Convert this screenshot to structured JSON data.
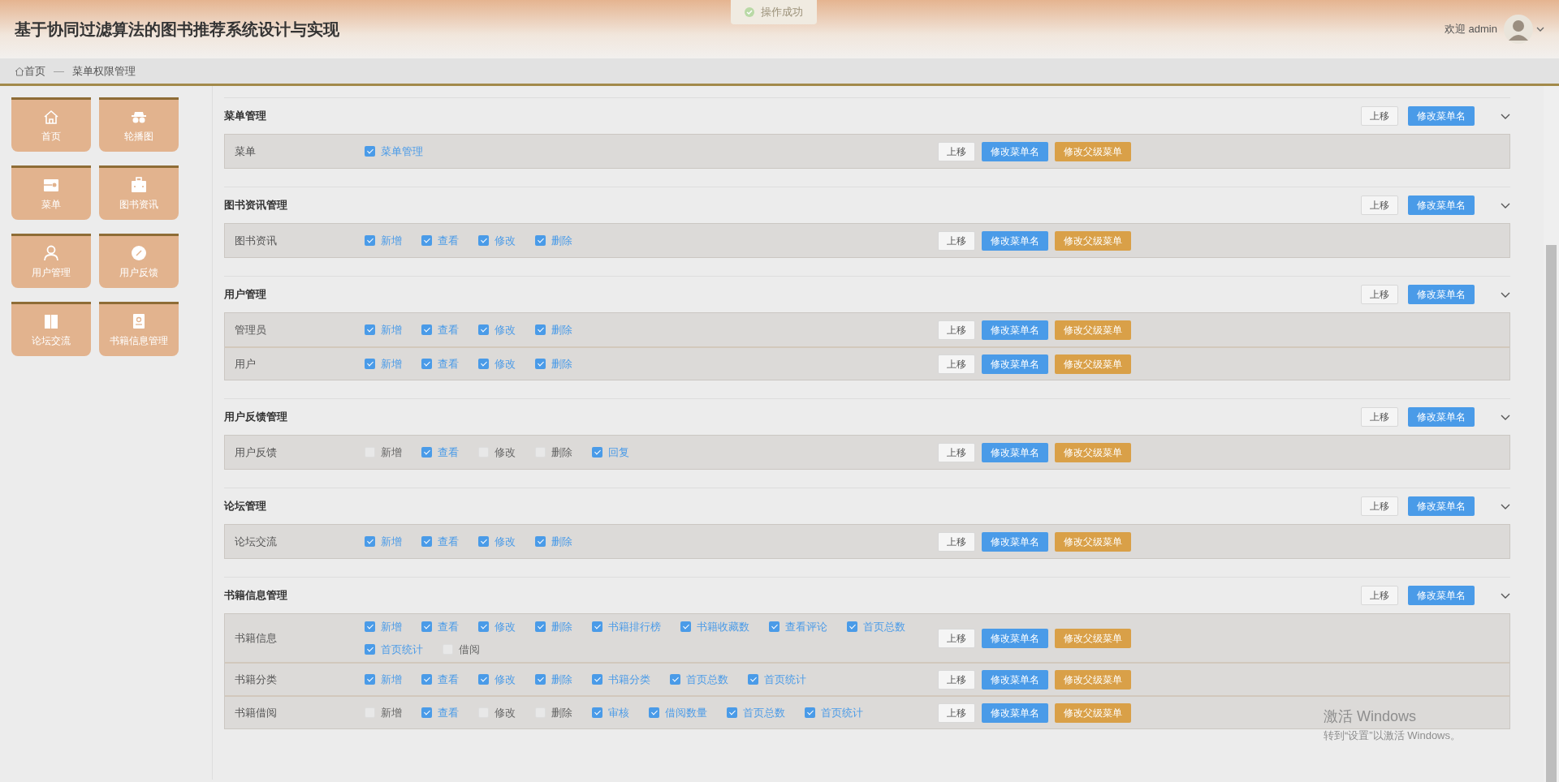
{
  "header": {
    "title": "基于协同过滤算法的图书推荐系统设计与实现",
    "welcome": "欢迎 admin"
  },
  "toast": {
    "text": "操作成功"
  },
  "breadcrumb": [
    {
      "label": "首页"
    },
    {
      "label": "—"
    },
    {
      "label": "菜单权限管理"
    }
  ],
  "sidebar": {
    "items": [
      {
        "label": "首页"
      },
      {
        "label": "轮播图"
      },
      {
        "label": "菜单"
      },
      {
        "label": "图书资讯"
      },
      {
        "label": "用户管理"
      },
      {
        "label": "用户反馈"
      },
      {
        "label": "论坛交流"
      },
      {
        "label": "书籍信息管理"
      }
    ]
  },
  "sections": [
    {
      "title": "菜单管理",
      "buttons": [
        "上移",
        "修改菜单名"
      ],
      "rows": [
        {
          "label": "菜单",
          "permissions": [
            {
              "label": "菜单管理",
              "checked": true
            }
          ],
          "buttons": [
            "上移",
            "修改菜单名",
            "修改父级菜单"
          ]
        }
      ]
    },
    {
      "title": "图书资讯管理",
      "buttons": [
        "上移",
        "修改菜单名"
      ],
      "rows": [
        {
          "label": "图书资讯",
          "permissions": [
            {
              "label": "新增",
              "checked": true
            },
            {
              "label": "查看",
              "checked": true
            },
            {
              "label": "修改",
              "checked": true
            },
            {
              "label": "删除",
              "checked": true
            }
          ],
          "buttons": [
            "上移",
            "修改菜单名",
            "修改父级菜单"
          ]
        }
      ]
    },
    {
      "title": "用户管理",
      "buttons": [
        "上移",
        "修改菜单名"
      ],
      "rows": [
        {
          "label": "管理员",
          "permissions": [
            {
              "label": "新增",
              "checked": true
            },
            {
              "label": "查看",
              "checked": true
            },
            {
              "label": "修改",
              "checked": true
            },
            {
              "label": "删除",
              "checked": true
            }
          ],
          "buttons": [
            "上移",
            "修改菜单名",
            "修改父级菜单"
          ]
        },
        {
          "label": "用户",
          "permissions": [
            {
              "label": "新增",
              "checked": true
            },
            {
              "label": "查看",
              "checked": true
            },
            {
              "label": "修改",
              "checked": true
            },
            {
              "label": "删除",
              "checked": true
            }
          ],
          "buttons": [
            "上移",
            "修改菜单名",
            "修改父级菜单"
          ]
        }
      ]
    },
    {
      "title": "用户反馈管理",
      "buttons": [
        "上移",
        "修改菜单名"
      ],
      "rows": [
        {
          "label": "用户反馈",
          "permissions": [
            {
              "label": "新增",
              "checked": false
            },
            {
              "label": "查看",
              "checked": true
            },
            {
              "label": "修改",
              "checked": false
            },
            {
              "label": "删除",
              "checked": false
            },
            {
              "label": "回复",
              "checked": true
            }
          ],
          "buttons": [
            "上移",
            "修改菜单名",
            "修改父级菜单"
          ]
        }
      ]
    },
    {
      "title": "论坛管理",
      "buttons": [
        "上移",
        "修改菜单名"
      ],
      "rows": [
        {
          "label": "论坛交流",
          "permissions": [
            {
              "label": "新增",
              "checked": true
            },
            {
              "label": "查看",
              "checked": true
            },
            {
              "label": "修改",
              "checked": true
            },
            {
              "label": "删除",
              "checked": true
            }
          ],
          "buttons": [
            "上移",
            "修改菜单名",
            "修改父级菜单"
          ]
        }
      ]
    },
    {
      "title": "书籍信息管理",
      "buttons": [
        "上移",
        "修改菜单名"
      ],
      "rows": [
        {
          "label": "书籍信息",
          "permissions": [
            {
              "label": "新增",
              "checked": true
            },
            {
              "label": "查看",
              "checked": true
            },
            {
              "label": "修改",
              "checked": true
            },
            {
              "label": "删除",
              "checked": true
            },
            {
              "label": "书籍排行榜",
              "checked": true
            },
            {
              "label": "书籍收藏数",
              "checked": true
            },
            {
              "label": "查看评论",
              "checked": true
            },
            {
              "label": "首页总数",
              "checked": true
            },
            {
              "label": "首页统计",
              "checked": true
            },
            {
              "label": "借阅",
              "checked": false
            }
          ],
          "buttons": [
            "上移",
            "修改菜单名",
            "修改父级菜单"
          ]
        },
        {
          "label": "书籍分类",
          "permissions": [
            {
              "label": "新增",
              "checked": true
            },
            {
              "label": "查看",
              "checked": true
            },
            {
              "label": "修改",
              "checked": true
            },
            {
              "label": "删除",
              "checked": true
            },
            {
              "label": "书籍分类",
              "checked": true
            },
            {
              "label": "首页总数",
              "checked": true
            },
            {
              "label": "首页统计",
              "checked": true
            }
          ],
          "buttons": [
            "上移",
            "修改菜单名",
            "修改父级菜单"
          ]
        },
        {
          "label": "书籍借阅",
          "permissions": [
            {
              "label": "新增",
              "checked": false
            },
            {
              "label": "查看",
              "checked": true
            },
            {
              "label": "修改",
              "checked": false
            },
            {
              "label": "删除",
              "checked": false
            },
            {
              "label": "审核",
              "checked": true
            },
            {
              "label": "借阅数量",
              "checked": true
            },
            {
              "label": "首页总数",
              "checked": true
            },
            {
              "label": "首页统计",
              "checked": true
            }
          ],
          "buttons": [
            "上移",
            "修改菜单名",
            "修改父级菜单"
          ]
        }
      ]
    }
  ],
  "os_notice": {
    "title": "激活 Windows",
    "text": "转到“设置”以激活 Windows。"
  }
}
